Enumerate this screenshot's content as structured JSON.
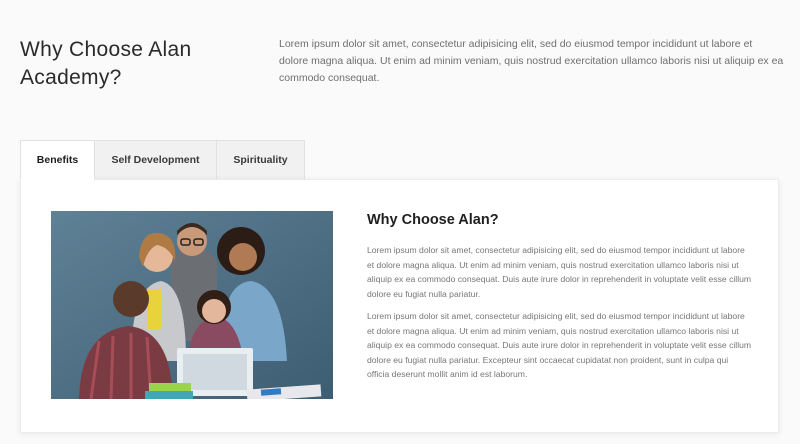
{
  "section": {
    "title": "Why Choose Alan Academy?",
    "intro": "Lorem ipsum dolor sit amet, consectetur adipisicing elit, sed do eiusmod tempor incididunt ut labore et dolore magna aliqua. Ut enim ad minim veniam, quis nostrud exercitation ullamco laboris nisi ut aliquip ex ea commodo consequat."
  },
  "tabs": [
    {
      "label": "Benefits",
      "active": true
    },
    {
      "label": "Self Development",
      "active": false
    },
    {
      "label": "Spirituality",
      "active": false
    }
  ],
  "panel": {
    "title": "Why Choose Alan?",
    "paragraphs": [
      "Lorem ipsum dolor sit amet, consectetur adipisicing elit, sed do eiusmod tempor incididunt ut labore et dolore magna aliqua. Ut enim ad minim veniam, quis nostrud exercitation ullamco laboris nisi ut aliquip ex ea commodo consequat. Duis aute irure dolor in reprehenderit in voluptate velit esse cillum dolore eu fugiat nulla pariatur.",
      "Lorem ipsum dolor sit amet, consectetur adipisicing elit, sed do eiusmod tempor incididunt ut labore et dolore magna aliqua. Ut enim ad minim veniam, quis nostrud exercitation ullamco laboris nisi ut aliquip ex ea commodo consequat. Duis aute irure dolor in reprehenderit in voluptate velit esse cillum dolore eu fugiat nulla pariatur. Excepteur sint occaecat cupidatat non proident, sunt in culpa qui officia deserunt mollit anim id est laborum."
    ]
  },
  "colors": {
    "photo_bg": "#4f7187",
    "text_dark": "#1f1f1f",
    "text_muted": "#777777"
  }
}
